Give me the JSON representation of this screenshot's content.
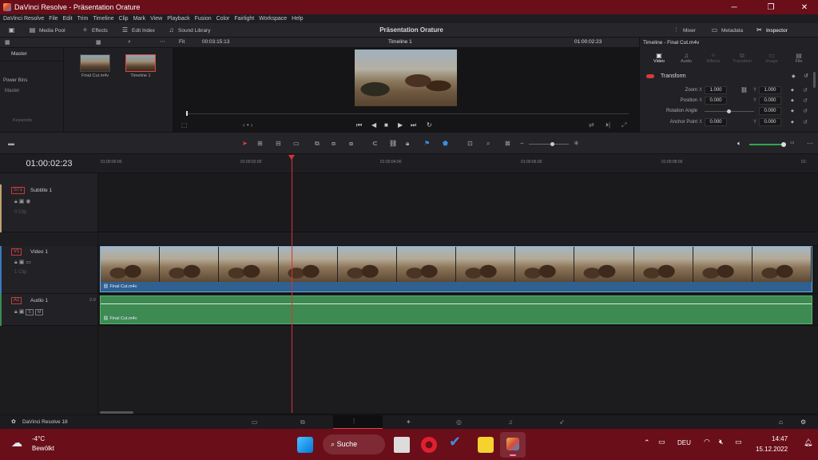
{
  "window": {
    "title": "DaVinci Resolve - Präsentation Orature"
  },
  "menu": [
    "DaVinci Resolve",
    "File",
    "Edit",
    "Trim",
    "Timeline",
    "Clip",
    "Mark",
    "View",
    "Playback",
    "Fusion",
    "Color",
    "Fairlight",
    "Workspace",
    "Help"
  ],
  "toolbar": {
    "media_pool": "Media Pool",
    "effects": "Effects",
    "edit_index": "Edit Index",
    "sound_library": "Sound Library",
    "project_title": "Präsentation Orature",
    "mixer": "Mixer",
    "metadata": "Metadata",
    "inspector": "Inspector"
  },
  "media_pool": {
    "bins": {
      "master": "Master",
      "power_bins": "Power Bins",
      "power_master": "Master",
      "keywords": "Keywords"
    },
    "clips": [
      {
        "label": "Final Cut.m4v"
      },
      {
        "label": "Timeline 1"
      }
    ]
  },
  "viewer": {
    "zoom": "Fit",
    "source_timecode": "00:03:15:13",
    "timeline_name": "Timeline 1",
    "record_timecode": "01:00:02:23"
  },
  "inspector": {
    "title": "Timeline - Final Cut.m4v",
    "tabs": [
      "Video",
      "Audio",
      "Effects",
      "Transition",
      "Image",
      "File"
    ],
    "section": "Transform",
    "rows": [
      {
        "label": "Zoom",
        "x": "1.000",
        "y": "1.000"
      },
      {
        "label": "Position",
        "x": "0.000",
        "y": "0.000"
      },
      {
        "label": "Rotation Angle",
        "x": "",
        "y": "0.000"
      },
      {
        "label": "Anchor Point",
        "x": "0.000",
        "y": "0.000"
      }
    ],
    "axis_x": "X",
    "axis_y": "Y"
  },
  "timeline": {
    "timecode": "01:00:02:23",
    "ruler": [
      "01:00:00:00",
      "01:00:02:00",
      "01:00:04:00",
      "01:00:06:00",
      "01:00:08:00"
    ],
    "tracks": {
      "subtitle": {
        "code": "ST1",
        "name": "Subtitle 1",
        "count": "0 Clip"
      },
      "video": {
        "code": "V1",
        "name": "Video 1",
        "count": "1 Clip",
        "clip": "Final Cut.m4v"
      },
      "audio": {
        "code": "A1",
        "name": "Audio 1",
        "channels": "2.0",
        "clip": "Final Cut.m4v",
        "solo": "S",
        "mute": "M"
      }
    }
  },
  "bottom": {
    "app_name": "DaVinci Resolve 18"
  },
  "taskbar": {
    "weather_temp": "-4°C",
    "weather_desc": "Bewölkt",
    "search": "Suche",
    "lang": "DEU",
    "time": "14:47",
    "date": "15.12.2022"
  },
  "colors": {
    "accent": "#e03030",
    "titlebar": "#6a0e1a",
    "video_clip": "#2f6090",
    "audio_clip": "#3d8a52"
  }
}
